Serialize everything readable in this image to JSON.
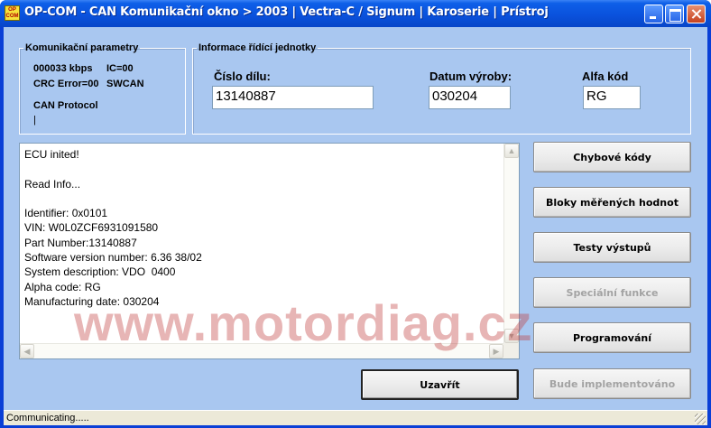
{
  "window": {
    "title": "OP-COM - CAN Komunikační okno > 2003 | Vectra-C / Signum | Karoserie | Prístroj",
    "icon_text_top": "OP",
    "icon_text_bottom": "COM"
  },
  "comm_params": {
    "legend": "Komunikační parametry",
    "baud": "000033 kbps",
    "ic": "IC=00",
    "crc": "CRC Error=00",
    "bus": "SWCAN",
    "protocol_label": "CAN Protocol",
    "protocol_value": "|"
  },
  "ecu_info": {
    "legend": "Informace řídící jednotky",
    "part_label": "Číslo dílu:",
    "part_value": "13140887",
    "date_label": "Datum výroby:",
    "date_value": "030204",
    "alpha_label": "Alfa kód",
    "alpha_value": "RG"
  },
  "log": {
    "lines": [
      "ECU inited!",
      "",
      "Read Info...",
      "",
      "Identifier: 0x0101",
      "VIN: W0L0ZCF6931091580",
      "Part Number:13140887",
      "Software version number: 6.36 38/02",
      "System description: VDO  0400",
      "Alpha code: RG",
      "Manufacturing date: 030204"
    ]
  },
  "watermark": "www.motordiag.cz",
  "buttons": {
    "chybove": "Chybové kódy",
    "bloky": "Bloky měřených hodnot",
    "testy": "Testy výstupů",
    "specialni": "Speciální funkce",
    "programovani": "Programování",
    "bude": "Bude implementováno",
    "uzavrit": "Uzavřít"
  },
  "status": {
    "text": "Communicating....."
  },
  "colors": {
    "titlebar": "#0a52dd",
    "client_bg": "#a9c7f0",
    "watermark": "#c03c3c"
  }
}
